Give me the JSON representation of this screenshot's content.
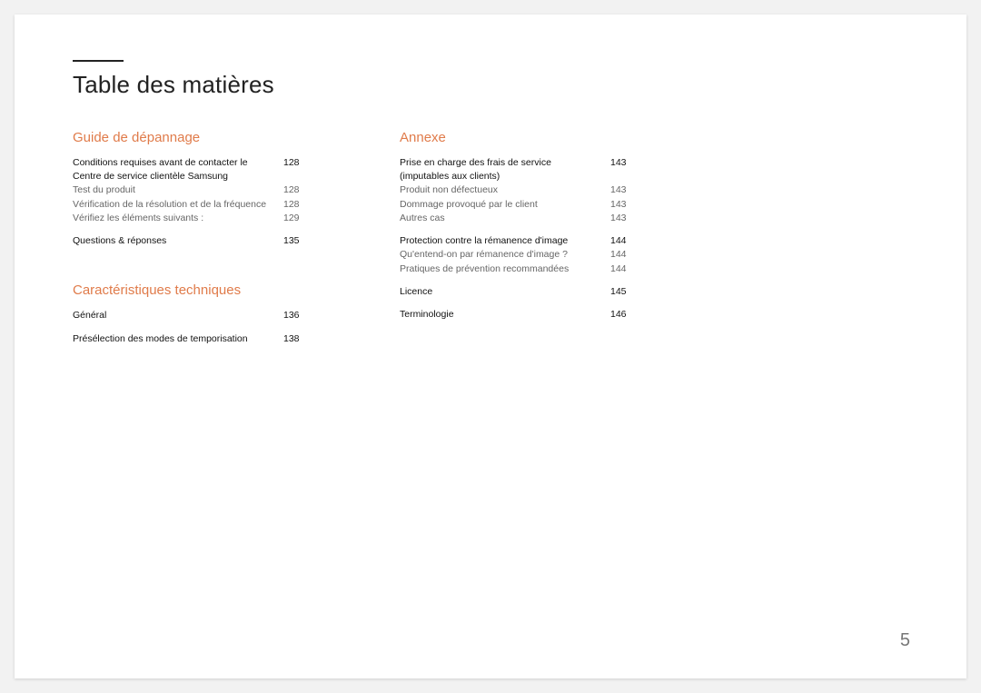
{
  "title": "Table des matières",
  "page_number": "5",
  "left_column": {
    "section1": {
      "heading": "Guide de dépannage",
      "g1_head": {
        "label": "Conditions requises avant de contacter le Centre de service clientèle Samsung",
        "page": "128"
      },
      "g1_sub1": {
        "label": "Test du produit",
        "page": "128"
      },
      "g1_sub2": {
        "label": "Vérification de la résolution et de la fréquence",
        "page": "128"
      },
      "g1_sub3": {
        "label": "Vérifiez les éléments suivants :",
        "page": "129"
      },
      "g2_head": {
        "label": "Questions & réponses",
        "page": "135"
      }
    },
    "section2": {
      "heading": "Caractéristiques techniques",
      "g1_head": {
        "label": "Général",
        "page": "136"
      },
      "g2_head": {
        "label": "Présélection des modes de temporisation",
        "page": "138"
      }
    }
  },
  "right_column": {
    "section1": {
      "heading": "Annexe",
      "g1_head": {
        "label": "Prise en charge des frais de service (imputables aux clients)",
        "page": "143"
      },
      "g1_sub1": {
        "label": "Produit non défectueux",
        "page": "143"
      },
      "g1_sub2": {
        "label": "Dommage provoqué par le client",
        "page": "143"
      },
      "g1_sub3": {
        "label": "Autres cas",
        "page": "143"
      },
      "g2_head": {
        "label": "Protection contre la rémanence d'image",
        "page": "144"
      },
      "g2_sub1": {
        "label": "Qu'entend-on par rémanence d'image ?",
        "page": "144"
      },
      "g2_sub2": {
        "label": "Pratiques de prévention recommandées",
        "page": "144"
      },
      "g3_head": {
        "label": "Licence",
        "page": "145"
      },
      "g4_head": {
        "label": "Terminologie",
        "page": "146"
      }
    }
  }
}
